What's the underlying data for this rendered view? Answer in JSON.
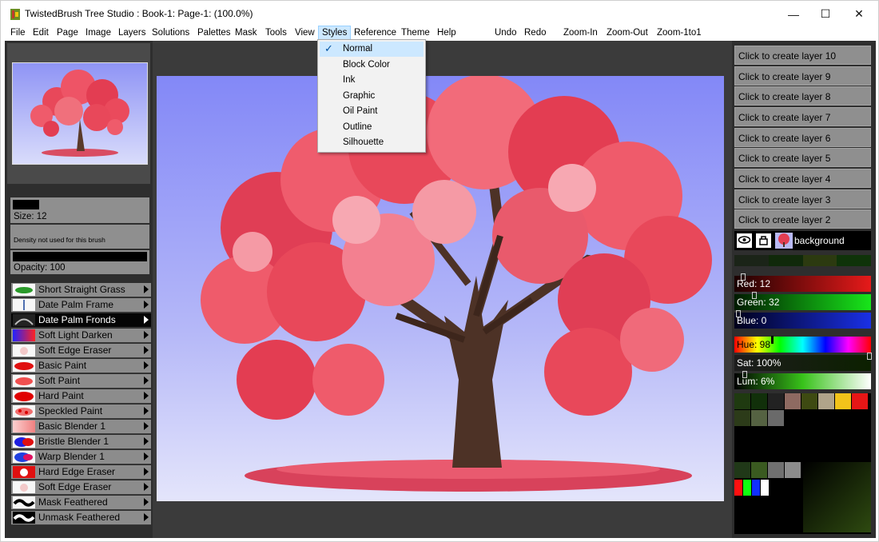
{
  "window": {
    "title": "TwistedBrush Tree Studio : Book-1: Page-1:  (100.0%)",
    "minimize": "—",
    "maximize": "☐",
    "close": "✕"
  },
  "menu": {
    "items": [
      "File",
      "Edit",
      "Page",
      "Image",
      "Layers",
      "Solutions",
      "Palettes",
      "Mask",
      "Tools",
      "View",
      "Styles",
      "Reference",
      "Theme",
      "Help"
    ],
    "actions": [
      "Undo",
      "Redo",
      "Zoom-In",
      "Zoom-Out",
      "Zoom-1to1"
    ],
    "active": "Styles"
  },
  "styles_menu": {
    "items": [
      "Normal",
      "Block Color",
      "Ink",
      "Graphic",
      "Oil Paint",
      "Outline",
      "Silhouette"
    ],
    "checked": "Normal",
    "check_glyph": "✓"
  },
  "brush": {
    "size_label": "Size: 12",
    "density_note": "Density not used for this brush",
    "opacity_label": "Opacity: 100"
  },
  "brushes": [
    {
      "name": "Short Straight Grass"
    },
    {
      "name": "Date Palm Frame"
    },
    {
      "name": "Date Palm Fronds",
      "selected": true
    },
    {
      "name": "Soft Light Darken"
    },
    {
      "name": "Soft Edge Eraser"
    },
    {
      "name": "Basic Paint"
    },
    {
      "name": "Soft Paint"
    },
    {
      "name": "Hard Paint"
    },
    {
      "name": "Speckled Paint"
    },
    {
      "name": "Basic Blender 1"
    },
    {
      "name": "Bristle Blender 1"
    },
    {
      "name": "Warp Blender 1"
    },
    {
      "name": "Hard Edge Eraser"
    },
    {
      "name": "Soft Edge Eraser"
    },
    {
      "name": "Mask Feathered"
    },
    {
      "name": "Unmask Feathered"
    }
  ],
  "layers": {
    "create_buttons": [
      "Click to create layer 10",
      "Click to create layer 9",
      "Click to create layer 8",
      "Click to create layer 7",
      "Click to create layer 6",
      "Click to create layer 5",
      "Click to create layer 4",
      "Click to create layer 3",
      "Click to create layer 2"
    ],
    "background_label": "background"
  },
  "color": {
    "red_label": "Red: 12",
    "green_label": "Green: 32",
    "blue_label": "Blue: 0",
    "hue_label": "Hue: 98",
    "sat_label": "Sat: 100%",
    "lum_label": "Lum: 6%",
    "red": 12,
    "green": 32,
    "blue": 0,
    "hue": 98,
    "sat": 100,
    "lum": 6,
    "current": "#0c2000"
  },
  "palette_colors": [
    "#1f3a10",
    "#11300a",
    "#222222",
    "#8e6a61",
    "#3e4a12",
    "#b0a48a",
    "#f2c31a",
    "#e61616",
    "#2c3b19",
    "#556242",
    "#6a6a6a"
  ],
  "palette_row2": [
    "#203818",
    "#3a5a20",
    "#707070",
    "#8c8c8c",
    "#555555"
  ],
  "palette_row3": [
    "#ff1010",
    "#10ff10",
    "#1030ff",
    "#ffffff"
  ]
}
